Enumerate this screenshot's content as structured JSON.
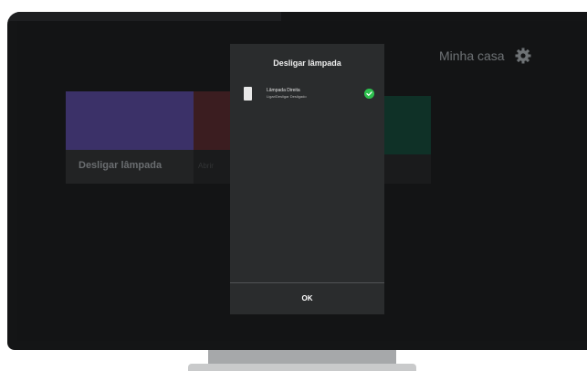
{
  "header": {
    "title": "Minha casa",
    "settings_icon": "gear-icon"
  },
  "cards": [
    {
      "label": "Desligar lâmpada",
      "color": "#3b3168"
    },
    {
      "label": "Abrir",
      "color": "#3b1d20"
    },
    {
      "label": "",
      "color": "#0f3127"
    }
  ],
  "dialog": {
    "title": "Desligar lâmpada",
    "device": {
      "name": "Lâmpada Direita",
      "status": "Ligar/Desligar Desligado",
      "icon": "lamp-switch-icon",
      "selected_icon": "check-icon",
      "selected_color": "#2dbf4e"
    },
    "ok_label": "OK"
  }
}
